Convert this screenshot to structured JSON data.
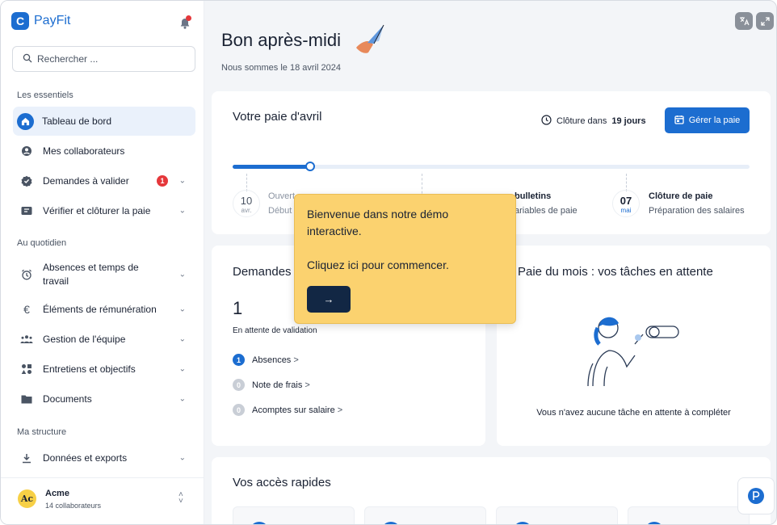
{
  "brand": {
    "name": "PayFit",
    "logo_letter": "C"
  },
  "search": {
    "placeholder": "Rechercher ..."
  },
  "sidebar": {
    "sections": [
      "Les essentiels",
      "Au quotidien",
      "Ma structure"
    ],
    "items": [
      {
        "label": "Tableau de bord",
        "icon": "home-icon",
        "active": true
      },
      {
        "label": "Mes collaborateurs",
        "icon": "user-icon"
      },
      {
        "label": "Demandes à valider",
        "icon": "check-badge-icon",
        "badge": "1"
      },
      {
        "label": "Vérifier et clôturer la paie",
        "icon": "ticket-icon"
      },
      {
        "label": "Absences et temps de travail",
        "icon": "alarm-clock-icon"
      },
      {
        "label": "Éléments de rémunération",
        "icon": "euro-icon",
        "glyph": "€"
      },
      {
        "label": "Gestion de l'équipe",
        "icon": "team-icon"
      },
      {
        "label": "Entretiens et objectifs",
        "icon": "shapes-icon"
      },
      {
        "label": "Documents",
        "icon": "folder-icon"
      },
      {
        "label": "Données et exports",
        "icon": "download-icon"
      }
    ]
  },
  "account": {
    "avatar": "Ac",
    "name": "Acme",
    "sub": "14 collaborateurs"
  },
  "header": {
    "greeting": "Bon après-midi",
    "date": "Nous sommes le 18 avril 2024"
  },
  "payroll": {
    "title": "Votre paie d'avril",
    "closing_prefix": "Clôture dans",
    "closing_days": "19 jours",
    "manage_button": "Gérer la paie",
    "progress": 0.15,
    "steps": [
      {
        "day": "10",
        "month": "avr.",
        "title": "Ouvert",
        "sub": "Début"
      },
      {
        "day": "",
        "month": "",
        "title": "bulletins",
        "sub": "ariables de paie"
      },
      {
        "day": "07",
        "month": "mai",
        "title": "Clôture de paie",
        "sub": "Préparation des salaires"
      }
    ]
  },
  "requests": {
    "title": "Demandes",
    "count": "1",
    "pending_label": "En attente de validation",
    "rows": [
      {
        "count": "1",
        "label": "Absences",
        "arrow": ">"
      },
      {
        "count": "0",
        "label": "Note de frais",
        "arrow": ">"
      },
      {
        "count": "0",
        "label": "Acomptes sur salaire",
        "arrow": ">"
      }
    ]
  },
  "tasks": {
    "title": "Paie du mois : vos tâches en attente",
    "empty": "Vous n'avez aucune tâche en attente à compléter"
  },
  "quick": {
    "title": "Vos accès rapides"
  },
  "tooltip": {
    "line1": "Bienvenue dans notre démo",
    "line2": "interactive.",
    "line3": "Cliquez ici pour commencer.",
    "button": "→"
  },
  "colors": {
    "accent": "#1c6dd0",
    "tooltip": "#fbd26f",
    "badge": "#e5383b",
    "dark_button": "#122744"
  }
}
